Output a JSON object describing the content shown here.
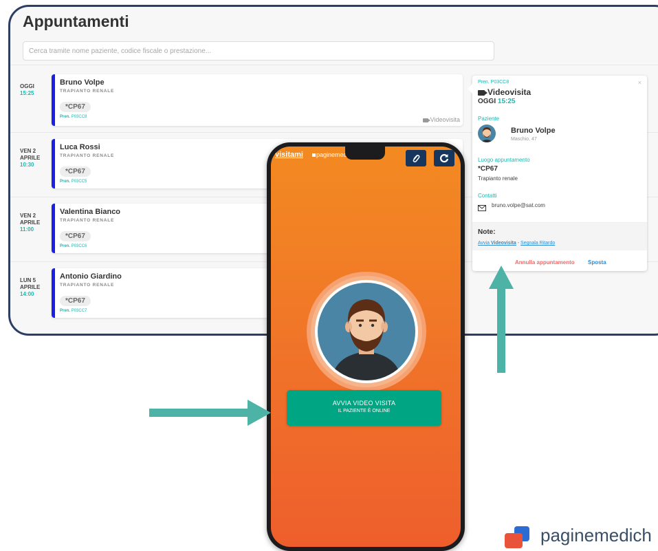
{
  "page_title": "Appuntamenti",
  "search": {
    "placeholder": "Cerca tramite nome paziente, codice fiscale o prestazione..."
  },
  "appointments": [
    {
      "day": "OGGI",
      "month": "",
      "time": "15:25",
      "name": "Bruno Volpe",
      "specialty": "TRAPIANTO RENALE",
      "code": "*CP67",
      "pren_label": "Pren.",
      "pren_id": "P03CC8",
      "type": "Videovisita"
    },
    {
      "day": "VEN 2",
      "month": "APRILE",
      "time": "10:30",
      "name": "Luca Rossi",
      "specialty": "TRAPIANTO RENALE",
      "code": "*CP67",
      "pren_label": "Pren.",
      "pren_id": "P03CC5",
      "type": ""
    },
    {
      "day": "VEN 2",
      "month": "APRILE",
      "time": "11:00",
      "name": "Valentina Bianco",
      "specialty": "TRAPIANTO RENALE",
      "code": "*CP67",
      "pren_label": "Pren.",
      "pren_id": "P03CC6",
      "type": ""
    },
    {
      "day": "LUN 5",
      "month": "APRILE",
      "time": "14:00",
      "name": "Antonio Giardino",
      "specialty": "TRAPIANTO RENALE",
      "code": "*CP67",
      "pren_label": "Pren.",
      "pren_id": "P03CC7",
      "type": ""
    }
  ],
  "detail": {
    "pren": "Pren. P03CC8",
    "type": "Videovisita",
    "day": "OGGI",
    "time": "15:25",
    "patient_label": "Paziente",
    "patient_name": "Bruno Volpe",
    "patient_info": "Maschio, 47",
    "location_label": "Luogo appuntamento",
    "location_code": "*CP67",
    "location_desc": "Trapianto renale",
    "contacts_label": "Contatti",
    "email": "bruno.volpe@sat.com",
    "notes_label": "Note:",
    "link_start_prefix": "Avvia",
    "link_start_bold": "Videovisita",
    "link_sep": "-",
    "link_delay": "Segnala Ritardo",
    "cancel": "Annulla appuntamento",
    "move": "Sposta",
    "close": "×"
  },
  "phone": {
    "brand": "visitami",
    "brand2": "paginemedi",
    "start_line1": "AVVIA VIDEO VISITA",
    "start_line2": "IL PAZIENTE È ONLINE"
  },
  "footer_logo": "paginemedich",
  "colors": {
    "accent_blue": "#1a20e6",
    "teal": "#1fb6b0",
    "orange": "#f38a21",
    "green": "#00a584",
    "arrow": "#4eb3a7",
    "frame": "#2d3e63"
  },
  "icons": [
    "videocam-icon",
    "close-icon",
    "mail-icon",
    "clip-icon",
    "refresh-icon",
    "avatar-icon",
    "arrow-right-icon",
    "arrow-up-icon",
    "logo-icon"
  ]
}
